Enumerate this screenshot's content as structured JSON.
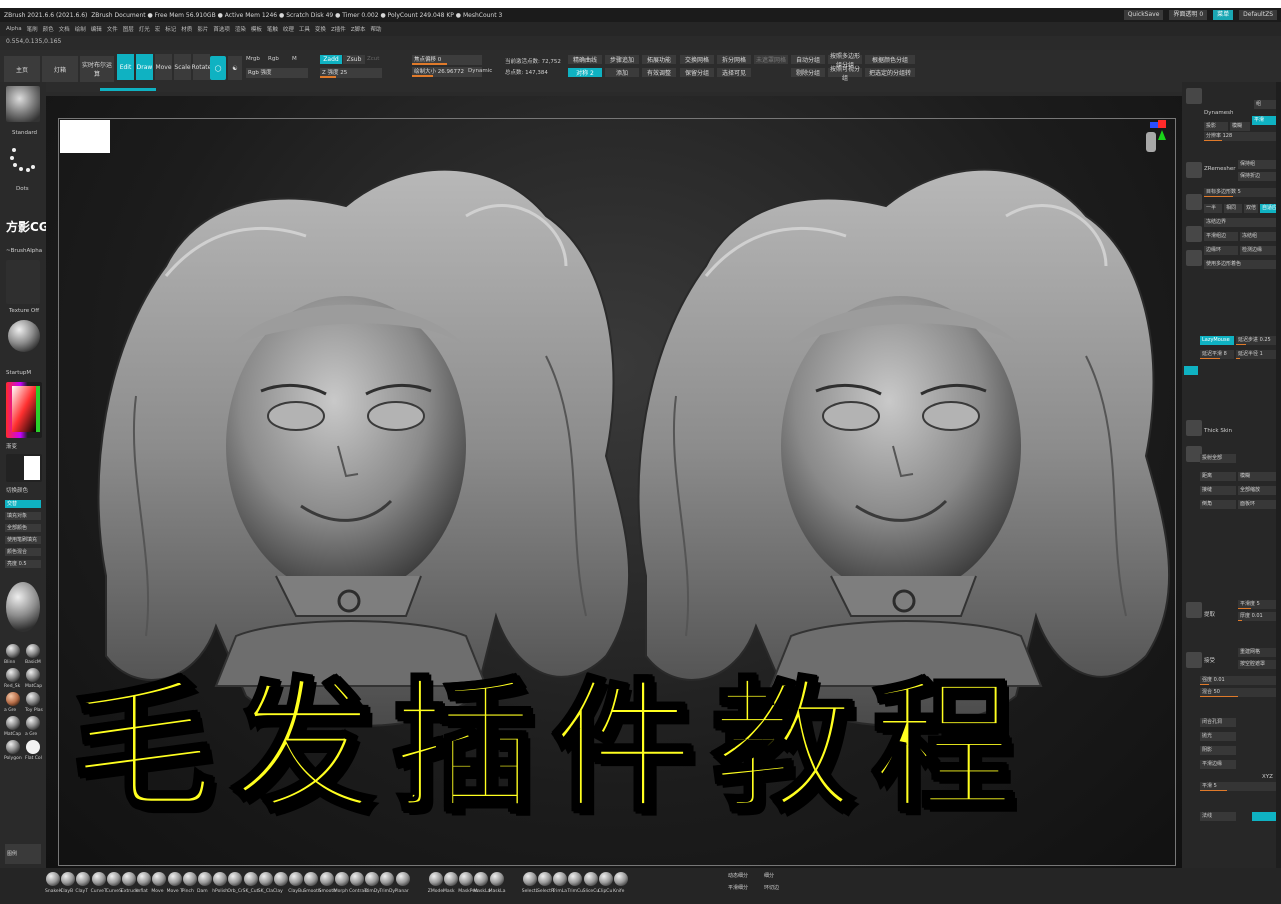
{
  "window": {
    "app_title": "ZBrush 2021.6.6 (2021.6.6)",
    "document": "ZBrush Document",
    "free_mem": "Free Mem 56.910GB",
    "active_mem": "Active Mem 1246",
    "scratch_disk": "Scratch Disk 49",
    "timer": "Timer 0.002",
    "poly_count": "PolyCount 249.048 KP",
    "mesh_count": "MeshCount 3",
    "quicksave": "QuickSave",
    "see_through": "界面透明 0",
    "menus_btn": "菜单",
    "default_script": "DefaultZS"
  },
  "menubar": {
    "items": [
      "Alpha",
      "笔刷",
      "颜色",
      "文档",
      "绘制",
      "编辑",
      "文件",
      "图层",
      "灯光",
      "宏",
      "标记",
      "材质",
      "影片",
      "首选项",
      "渲染",
      "模板",
      "笔触",
      "纹理",
      "工具",
      "变换",
      "Z插件",
      "Z脚本",
      "帮助"
    ]
  },
  "coords": "0.554,0.135,0.165",
  "toolbar": {
    "lightbox": "主页",
    "lightbox2": "灯箱",
    "live_boolean": "实时布尔运算",
    "edit": "Edit",
    "draw": "Draw",
    "move": "Move",
    "scale": "Scale",
    "rotate": "Rotate",
    "mrgb": "Mrgb",
    "rgb": "Rgb",
    "m": "M",
    "rgb_intensity": "Rgb 强度",
    "zadd": "Zadd",
    "zsub": "Zsub",
    "zcut": "Zcut",
    "z_intensity": "Z 强度 25",
    "focal_shift": "焦点偏移 0",
    "draw_size": "绘制大小 26.96772",
    "dynamic": "Dynamic",
    "active_points": "当前激活点数: 72,752",
    "total_points": "总点数: 147,384",
    "smooth_curve": "精确曲线",
    "multi_add": "步骤追加",
    "curve_strength": "拓展功能",
    "symmetry": "对称 2",
    "adapt": "添加",
    "brush_modifier": "有效调整",
    "clip": "交换网格",
    "split": "拆分网格",
    "unmasked": "未遮罩网格",
    "new_section": "保留分组",
    "split_hidden": "选择可见",
    "group_visible": "自动分组",
    "polygroup_btn1": "按照多边形组分组",
    "polygroup_btn2": "根据颜色分组",
    "polygroup_btn3": "剔除分组",
    "polygroup_btn4": "按照可视分组",
    "polygroup_btn5": "把选定的分组转",
    "polygroup_btn6": "把四边面分组"
  },
  "leftpanel": {
    "standard": "Standard",
    "dots": "Dots",
    "logo": "方影CG",
    "brush_alpha": "~BrushAlpha",
    "texture_off": "Texture Off",
    "starter": "StartupM",
    "gradient": "渐变",
    "switch_color": "切换颜色",
    "alternate": "交替",
    "fill_layer": "填充对象",
    "clear_color": "全部颜色",
    "fill_object": "使用笔刷填充",
    "mix": "颜色混合",
    "density": "亮度 0.5",
    "blinn": "Blinn",
    "basic": "BasicM",
    "red_sk": "Red_Sk",
    "matcap": "MatCap",
    "toy": "Toy Plas",
    "matcap2": "MatCap",
    "skin": "a Gre",
    "grey": "a Gre",
    "fast": "Flat Col",
    "pastel": "Polygon",
    "bottom_btn": "图例"
  },
  "title_overlay": "毛发插件教程",
  "rightpanel": {
    "dynamesh": "Dynamesh",
    "group": "组",
    "project": "投影",
    "blur": "模糊",
    "flat": "平滑",
    "resolution": "分辨率 128",
    "zremesher": "ZRemesher",
    "keep_groups": "保持组",
    "keep_creases": "保持折边",
    "target_count": "目标多边形数 5",
    "half": "一半",
    "same": "相同",
    "double": "双倍",
    "adapt": "自适应",
    "freeze_borders": "冻结边界",
    "smooth_groups": "平滑组边",
    "freeze_groups": "冻结组",
    "edge_loop": "边缘环",
    "detect_edges": "检测边缘",
    "use_polypaint": "使用多边形着色",
    "lazy_mouse": "LazyMouse",
    "lazy_step": "延迟步进 0.25",
    "lazy_smooth": "延迟平滑 8",
    "lazy_radius": "延迟半径 1",
    "thick_skin": "Thick Skin",
    "project_all": "投射全部",
    "dist": "距离",
    "pa_blur": "模糊",
    "seam": "接缝",
    "zoom_all": "全部缩放",
    "bevel": "倒角",
    "panel_loops": "面板环",
    "extract": "提取",
    "thickness": "厚度 0.01",
    "smooth_5": "平滑度 5",
    "accept": "接受",
    "remesh_all": "重建网格",
    "mask_by_cavity": "按空腔遮罩",
    "intensity": "强度 0.01",
    "blend": "混合 50",
    "xyz": "XYZ",
    "smooth_val": "平滑 5",
    "close_holes": "闭合孔洞",
    "polish": "抛光",
    "shadow": "阴影",
    "normal": "法线",
    "smooth_edge": "平滑边缘"
  },
  "bottombar": {
    "brushes": [
      "SnakeH",
      "ClayB",
      "ClayT",
      "CurveT",
      "CurveS",
      "Extrude",
      "Inflat",
      "Move",
      "Move T",
      "Pinch",
      "Dam",
      "hPolish",
      "Orb_Cr",
      "SK_Cut",
      "SK_Cla",
      "Clay",
      "ClayBu",
      "Smooth",
      "Smooth",
      "Morph",
      "Contrast",
      "TrimDy",
      "TrimDy",
      "Planar",
      "ZModel",
      "Mask",
      "MaskPen",
      "MaskLa",
      "MaskLa",
      "SelectL",
      "SelectR",
      "TrimLa",
      "TrimCu",
      "SliceCu",
      "ClipCu",
      "Knife"
    ],
    "dynamic": "动态细分",
    "subdivide": "细分",
    "smooth_sub": "平滑细分",
    "edge_loop": "环切边"
  }
}
